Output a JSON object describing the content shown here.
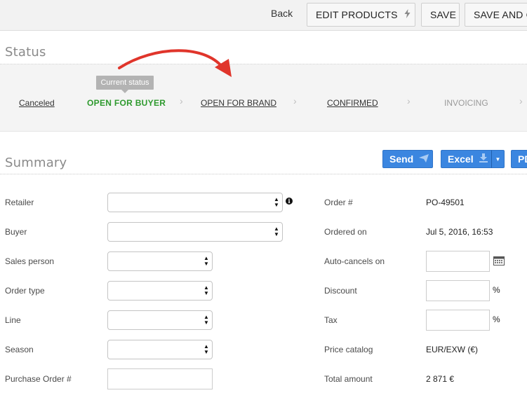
{
  "toolbar": {
    "back_label": "Back",
    "edit_products_label": "EDIT PRODUCTS",
    "save_label": "SAVE",
    "save_and_close_label": "SAVE AND C"
  },
  "status": {
    "title": "Status",
    "tooltip": "Current status",
    "steps": [
      {
        "label": "Canceled",
        "state": "link"
      },
      {
        "label": "OPEN FOR BUYER",
        "state": "current"
      },
      {
        "label": "OPEN FOR BRAND",
        "state": "link"
      },
      {
        "label": "CONFIRMED",
        "state": "link"
      },
      {
        "label": "INVOICING",
        "state": "future"
      }
    ],
    "annotation_color": "#e0352b",
    "current_color": "#2e9a2e"
  },
  "summary": {
    "title": "Summary",
    "buttons": {
      "send_label": "Send",
      "excel_label": "Excel",
      "pdf_label": "PD"
    },
    "accent_color": "#3b86e0",
    "left_fields": [
      {
        "label": "Retailer",
        "value": ""
      },
      {
        "label": "Buyer",
        "value": ""
      },
      {
        "label": "Sales person",
        "value": ""
      },
      {
        "label": "Order type",
        "value": ""
      },
      {
        "label": "Line",
        "value": ""
      },
      {
        "label": "Season",
        "value": ""
      },
      {
        "label": "Purchase Order #",
        "value": ""
      }
    ],
    "right_fields": [
      {
        "label": "Order #",
        "value": "PO-49501"
      },
      {
        "label": "Ordered on",
        "value": "Jul 5, 2016, 16:53"
      },
      {
        "label": "Auto-cancels on",
        "value": ""
      },
      {
        "label": "Discount",
        "value": "",
        "unit": "%"
      },
      {
        "label": "Tax",
        "value": "",
        "unit": "%"
      },
      {
        "label": "Price catalog",
        "value": "EUR/EXW (€)"
      },
      {
        "label": "Total amount",
        "value": "2 871 €"
      }
    ]
  },
  "icons": {
    "edit_products": "bolt-icon",
    "send": "paper-plane-icon",
    "excel": "download-icon",
    "retailer_info": "info-icon",
    "auto_cancels": "calendar-icon"
  }
}
